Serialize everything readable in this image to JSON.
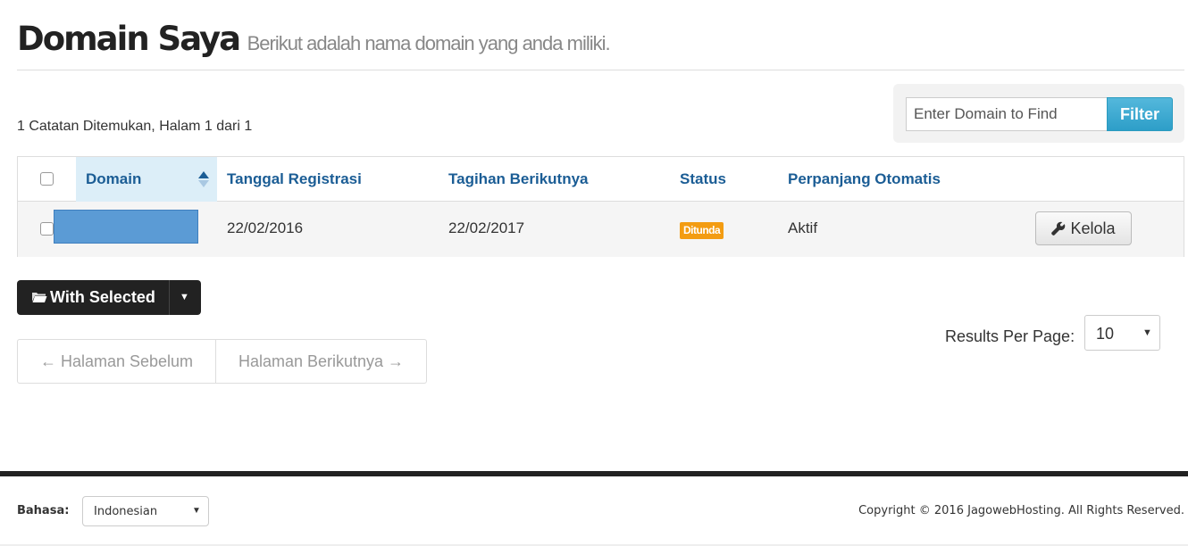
{
  "header": {
    "title": "Domain Saya",
    "subtitle": "Berikut adalah nama domain yang anda miliki."
  },
  "records_info": "1 Catatan Ditemukan, Halam 1 dari 1",
  "filter": {
    "placeholder": "Enter Domain to Find",
    "button_label": "Filter"
  },
  "table": {
    "columns": {
      "domain": "Domain",
      "registration_date": "Tanggal Registrasi",
      "next_due": "Tagihan Berikutnya",
      "status": "Status",
      "auto_renew": "Perpanjang Otomatis"
    },
    "rows": [
      {
        "registration_date": "22/02/2016",
        "next_due": "22/02/2017",
        "status": "Ditunda",
        "auto_renew": "Aktif",
        "manage_label": "Kelola"
      }
    ]
  },
  "actions": {
    "with_selected_label": "With Selected"
  },
  "pagination": {
    "prev_label": "← Halaman Sebelum",
    "next_label": "Halaman Berikutnya →"
  },
  "results_per_page": {
    "label": "Results Per Page:",
    "value": "10"
  },
  "footer": {
    "language_label": "Bahasa:",
    "language_value": "Indonesian",
    "copyright": "Copyright © 2016 JagowebHosting. All Rights Reserved."
  },
  "colors": {
    "status_pending": "#f39c12",
    "filter_button": "#2d9ec8",
    "header_link": "#1b5d95",
    "redacted_domain": "#5b9bd5"
  },
  "icons": {
    "sort": "sort-ascending-icon",
    "wrench": "wrench-icon",
    "folder": "folder-icon",
    "caret": "caret-down-icon"
  }
}
